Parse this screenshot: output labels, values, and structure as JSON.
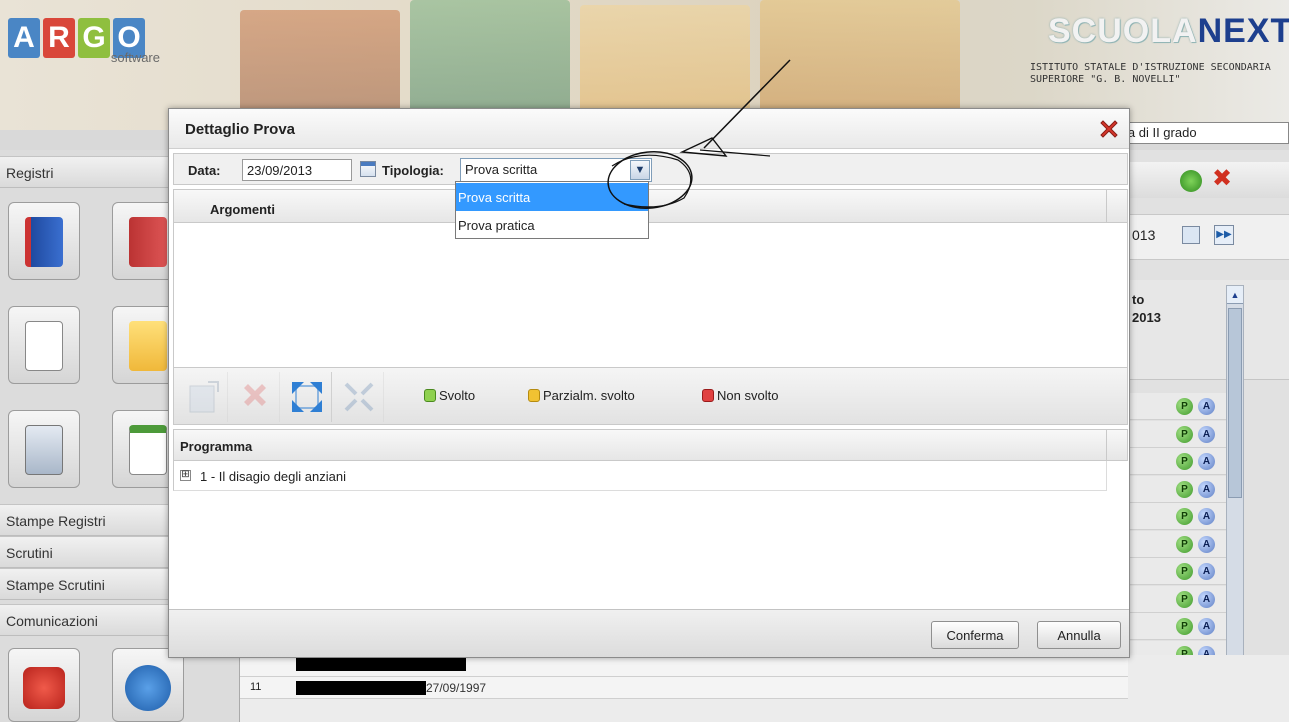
{
  "app": {
    "logo_letters": [
      "A",
      "R",
      "G",
      "O"
    ],
    "logo_sub": "software",
    "brand_part1": "SCUOLA",
    "brand_part2": "NEXT",
    "school_name": "ISTITUTO STATALE D'ISTRUZIONE SECONDARIA SUPERIORE \"G. B. NOVELLI\"",
    "grade_select": "ia di II grado"
  },
  "sidebar": {
    "registri_label": "Registri",
    "menu": [
      "Stampe Registri",
      "Scrutini",
      "Stampe Scrutini",
      "Comunicazioni"
    ]
  },
  "background": {
    "date_fragment": "013",
    "column_header_line1": "to",
    "column_header_line2": "2013",
    "row_number": "11",
    "birth_date": "27/09/1997",
    "p_label": "P",
    "a_label": "A"
  },
  "modal": {
    "title": "Dettaglio Prova",
    "date_label": "Data:",
    "date_value": "23/09/2013",
    "type_label": "Tipologia:",
    "type_value": "Prova scritta",
    "type_options": [
      "Prova scritta",
      "Prova pratica"
    ],
    "arguments_header": "Argomenti",
    "toolbar": {
      "done": "Svolto",
      "partial": "Parzialm. svolto",
      "not_done": "Non svolto"
    },
    "program_header": "Programma",
    "program_items": [
      {
        "expander": "⊞",
        "label": "1 - Il disagio degli anziani"
      }
    ],
    "confirm": "Conferma",
    "cancel": "Annulla"
  },
  "colors": {
    "argo_blue": "#4a86c5",
    "argo_red": "#d9473a",
    "argo_green": "#8fbf3f",
    "selection_blue": "#3399ff",
    "cube_green": "#8fd14f",
    "cube_yellow": "#f1c232",
    "cube_red": "#e04040"
  }
}
